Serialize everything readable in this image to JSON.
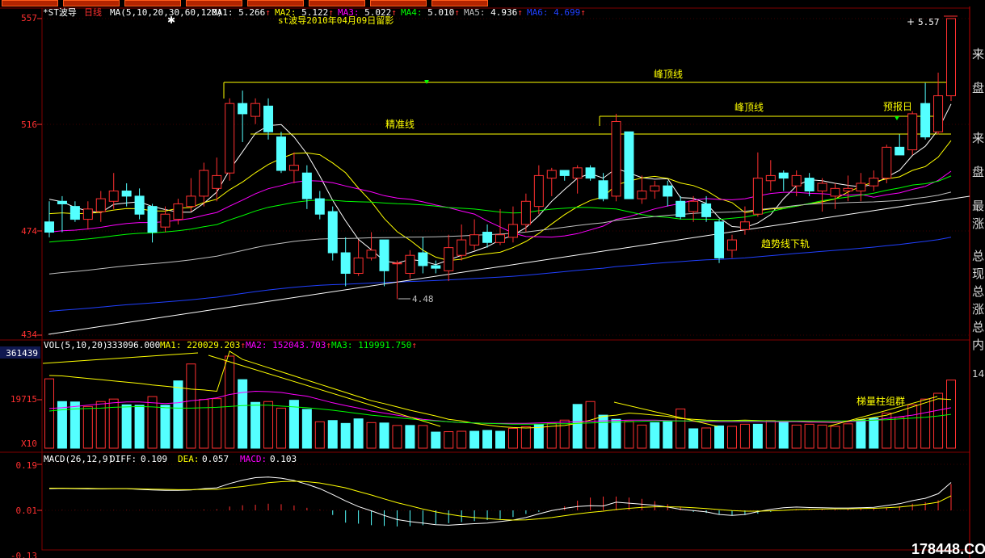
{
  "toolbar": {
    "button_count": 8
  },
  "main": {
    "stock_name": "*ST波导",
    "period": "日线",
    "ma_header": "MA(5,10,20,30,60,120)",
    "ma_values": [
      {
        "label": "MA1:",
        "value": "5.266",
        "color": "#ffffff"
      },
      {
        "label": "MA2:",
        "value": "5.122",
        "color": "#ffff00"
      },
      {
        "label": "MA3:",
        "value": "5.022",
        "color": "#ff00ff"
      },
      {
        "label": "MA4:",
        "value": "5.010",
        "color": "#00ff00"
      },
      {
        "label": "MA5:",
        "value": "4.936",
        "color": "#c0c0c0"
      },
      {
        "label": "MA6:",
        "value": "4.699",
        "color": "#2040ff"
      }
    ],
    "note": "st波导2010年04月09日留影",
    "y_labels": [
      "557",
      "516",
      "474",
      "434"
    ],
    "max_label": "5.57",
    "min_label": "4.48",
    "annotations": {
      "peak1": "峰顶线",
      "peak2": "峰顶线",
      "precise": "精准线",
      "forecast": "预报日",
      "trend": "趋势线下轨",
      "ladder": "梯量柱组群"
    }
  },
  "volume": {
    "header": "VOL(5,10,20)",
    "vol_value": "333096.000",
    "ma_values": [
      {
        "label": "MA1:",
        "value": "220029.203",
        "color": "#ffff00"
      },
      {
        "label": "MA2:",
        "value": "152043.703",
        "color": "#ff00ff"
      },
      {
        "label": "MA3:",
        "value": "119991.750",
        "color": "#00ff00"
      }
    ],
    "y_top": "361439",
    "y_mid": "19715",
    "unit": "X10"
  },
  "macd": {
    "header": "MACD(26,12,9)",
    "diff": {
      "label": "DIFF:",
      "value": "0.109"
    },
    "dea": {
      "label": "DEA:",
      "value": "0.057"
    },
    "macd": {
      "label": "MACD:",
      "value": "0.103"
    },
    "y_labels": [
      "0.19",
      "0.01",
      "-0.13"
    ]
  },
  "right_panel": [
    "来",
    "盘",
    "来",
    "盘",
    "最",
    "涨",
    "总",
    "现",
    "总",
    "涨",
    "总",
    "内",
    "14"
  ],
  "watermark": "178448.COM",
  "chart_data": {
    "type": "candlestick",
    "ylim": [
      4.34,
      5.57
    ],
    "candles": [
      [
        4.78,
        4.74,
        4.86,
        4.72
      ],
      [
        4.86,
        4.85,
        4.88,
        4.74
      ],
      [
        4.84,
        4.79,
        4.86,
        4.78
      ],
      [
        4.79,
        4.83,
        4.86,
        4.75
      ],
      [
        4.82,
        4.87,
        4.9,
        4.78
      ],
      [
        4.86,
        4.9,
        4.97,
        4.83
      ],
      [
        4.9,
        4.88,
        4.93,
        4.84
      ],
      [
        4.88,
        4.81,
        4.91,
        4.79
      ],
      [
        4.84,
        4.74,
        4.85,
        4.7
      ],
      [
        4.76,
        4.81,
        4.84,
        4.74
      ],
      [
        4.79,
        4.85,
        4.87,
        4.77
      ],
      [
        4.84,
        4.88,
        4.95,
        4.82
      ],
      [
        4.88,
        4.98,
        5.01,
        4.84
      ],
      [
        4.91,
        4.96,
        5.03,
        4.86
      ],
      [
        4.97,
        5.24,
        5.26,
        4.94
      ],
      [
        5.24,
        5.2,
        5.29,
        5.09
      ],
      [
        5.19,
        5.24,
        5.26,
        5.16
      ],
      [
        5.23,
        5.13,
        5.26,
        5.1
      ],
      [
        5.11,
        4.98,
        5.13,
        4.97
      ],
      [
        4.98,
        5.0,
        5.05,
        4.93
      ],
      [
        4.97,
        4.87,
        5.0,
        4.83
      ],
      [
        4.87,
        4.81,
        4.9,
        4.79
      ],
      [
        4.82,
        4.66,
        4.84,
        4.63
      ],
      [
        4.66,
        4.58,
        4.72,
        4.53
      ],
      [
        4.58,
        4.64,
        4.71,
        4.57
      ],
      [
        4.64,
        4.67,
        4.74,
        4.63
      ],
      [
        4.71,
        4.59,
        4.71,
        4.53
      ],
      [
        4.62,
        4.62,
        4.63,
        4.48
      ],
      [
        4.58,
        4.65,
        4.67,
        4.56
      ],
      [
        4.66,
        4.61,
        4.72,
        4.58
      ],
      [
        4.61,
        4.6,
        4.63,
        4.58
      ],
      [
        4.59,
        4.68,
        4.73,
        4.55
      ],
      [
        4.65,
        4.71,
        4.77,
        4.63
      ],
      [
        4.69,
        4.73,
        4.79,
        4.67
      ],
      [
        4.74,
        4.7,
        4.77,
        4.68
      ],
      [
        4.7,
        4.73,
        4.83,
        4.69
      ],
      [
        4.72,
        4.77,
        4.84,
        4.7
      ],
      [
        4.77,
        4.86,
        4.89,
        4.74
      ],
      [
        4.84,
        4.96,
        5.0,
        4.81
      ],
      [
        4.95,
        4.98,
        4.99,
        4.88
      ],
      [
        4.98,
        4.96,
        4.98,
        4.94
      ],
      [
        4.95,
        4.99,
        5.0,
        4.89
      ],
      [
        4.99,
        4.95,
        5.0,
        4.94
      ],
      [
        4.94,
        4.87,
        4.97,
        4.86
      ],
      [
        4.88,
        5.17,
        5.2,
        4.86
      ],
      [
        5.13,
        4.87,
        5.13,
        4.87
      ],
      [
        4.87,
        4.9,
        4.96,
        4.85
      ],
      [
        4.9,
        4.92,
        4.94,
        4.87
      ],
      [
        4.92,
        4.88,
        4.94,
        4.84
      ],
      [
        4.86,
        4.8,
        4.88,
        4.79
      ],
      [
        4.82,
        4.86,
        4.88,
        4.78
      ],
      [
        4.85,
        4.8,
        4.88,
        4.78
      ],
      [
        4.78,
        4.64,
        4.79,
        4.62
      ],
      [
        4.67,
        4.71,
        4.73,
        4.64
      ],
      [
        4.75,
        4.78,
        4.84,
        4.73
      ],
      [
        4.81,
        4.95,
        5.05,
        4.8
      ],
      [
        4.94,
        4.96,
        5.02,
        4.9
      ],
      [
        4.97,
        4.95,
        4.98,
        4.9
      ],
      [
        4.92,
        4.96,
        4.98,
        4.88
      ],
      [
        4.95,
        4.9,
        4.97,
        4.88
      ],
      [
        4.9,
        4.93,
        4.95,
        4.82
      ],
      [
        4.88,
        4.91,
        4.93,
        4.83
      ],
      [
        4.9,
        4.91,
        4.96,
        4.86
      ],
      [
        4.9,
        4.93,
        4.97,
        4.86
      ],
      [
        4.92,
        4.95,
        4.98,
        4.9
      ],
      [
        4.95,
        5.07,
        5.08,
        4.93
      ],
      [
        5.07,
        5.04,
        5.12,
        5.04
      ],
      [
        5.06,
        5.2,
        5.21,
        5.04
      ],
      [
        5.24,
        5.11,
        5.32,
        5.1
      ],
      [
        5.13,
        5.27,
        5.36,
        5.12
      ],
      [
        5.27,
        5.57,
        5.57,
        5.25
      ]
    ],
    "volume_bars": [
      [
        168,
        1
      ],
      [
        113,
        0
      ],
      [
        112,
        0
      ],
      [
        101,
        1
      ],
      [
        113,
        1
      ],
      [
        119,
        1
      ],
      [
        105,
        0
      ],
      [
        104,
        0
      ],
      [
        125,
        1
      ],
      [
        104,
        0
      ],
      [
        163,
        0
      ],
      [
        204,
        1
      ],
      [
        118,
        1
      ],
      [
        120,
        1
      ],
      [
        223,
        1
      ],
      [
        166,
        0
      ],
      [
        111,
        0
      ],
      [
        113,
        1
      ],
      [
        97,
        1
      ],
      [
        116,
        0
      ],
      [
        94,
        0
      ],
      [
        64,
        1
      ],
      [
        67,
        0
      ],
      [
        60,
        0
      ],
      [
        71,
        0
      ],
      [
        62,
        1
      ],
      [
        61,
        0
      ],
      [
        55,
        1
      ],
      [
        55,
        0
      ],
      [
        55,
        1
      ],
      [
        39,
        0
      ],
      [
        40,
        1
      ],
      [
        41,
        1
      ],
      [
        41,
        0
      ],
      [
        43,
        0
      ],
      [
        41,
        0
      ],
      [
        48,
        1
      ],
      [
        52,
        1
      ],
      [
        57,
        0
      ],
      [
        60,
        1
      ],
      [
        68,
        1
      ],
      [
        106,
        0
      ],
      [
        113,
        1
      ],
      [
        80,
        0
      ],
      [
        70,
        0
      ],
      [
        65,
        1
      ],
      [
        56,
        1
      ],
      [
        62,
        0
      ],
      [
        64,
        0
      ],
      [
        95,
        1
      ],
      [
        47,
        0
      ],
      [
        49,
        1
      ],
      [
        54,
        0
      ],
      [
        53,
        1
      ],
      [
        58,
        1
      ],
      [
        58,
        0
      ],
      [
        67,
        1
      ],
      [
        63,
        0
      ],
      [
        56,
        1
      ],
      [
        58,
        1
      ],
      [
        56,
        1
      ],
      [
        53,
        1
      ],
      [
        59,
        1
      ],
      [
        69,
        0
      ],
      [
        73,
        0
      ],
      [
        85,
        1
      ],
      [
        75,
        1
      ],
      [
        105,
        1
      ],
      [
        119,
        1
      ],
      [
        133,
        1
      ],
      [
        165,
        1
      ]
    ],
    "volume_ma": [
      [
        176,
        175,
        172,
        169,
        166,
        163,
        160,
        157,
        153,
        150,
        147,
        143,
        141,
        138,
        235,
        215,
        205,
        195,
        185,
        175,
        165,
        155,
        145,
        135,
        125,
        115,
        108,
        100,
        92,
        85,
        78,
        70,
        66,
        60,
        56,
        52,
        50,
        49,
        50,
        53,
        55,
        60,
        68,
        77,
        80,
        85,
        83,
        80,
        77,
        72,
        70,
        68,
        67,
        67,
        68,
        67,
        66,
        65,
        65,
        64,
        63,
        62,
        65,
        70,
        75,
        80,
        90,
        100,
        110,
        120,
        118
      ],
      [
        96,
        98,
        101,
        104,
        107,
        110,
        112,
        112,
        110,
        108,
        110,
        115,
        118,
        122,
        130,
        135,
        138,
        137,
        135,
        130,
        126,
        118,
        110,
        103,
        97,
        90,
        85,
        80,
        75,
        70,
        67,
        64,
        62,
        61,
        60,
        60,
        60,
        60,
        61,
        62,
        63,
        64,
        65,
        66,
        67,
        68,
        68,
        68,
        67,
        66,
        65,
        64,
        64,
        64,
        64,
        64,
        64,
        64,
        64,
        63,
        63,
        63,
        64,
        66,
        68,
        72,
        76,
        80,
        86,
        92,
        98
      ],
      [
        90,
        93,
        95,
        96,
        97,
        99,
        100,
        101,
        100,
        98,
        97,
        97,
        98,
        99,
        101,
        103,
        104,
        104,
        102,
        100,
        98,
        95,
        92,
        88,
        84,
        80,
        77,
        74,
        71,
        68,
        66,
        64,
        62,
        61,
        60,
        59,
        58,
        58,
        58,
        59,
        59,
        60,
        61,
        62,
        63,
        64,
        65,
        66,
        66,
        66,
        66,
        66,
        66,
        66,
        66,
        66,
        66,
        66,
        66,
        66,
        66,
        66,
        66,
        67,
        68,
        69,
        71,
        73,
        75,
        78,
        82
      ]
    ],
    "macd": {
      "diff": [
        0.085,
        0.086,
        0.085,
        0.084,
        0.084,
        0.085,
        0.085,
        0.082,
        0.08,
        0.078,
        0.078,
        0.08,
        0.085,
        0.088,
        0.105,
        0.118,
        0.128,
        0.13,
        0.126,
        0.117,
        0.102,
        0.085,
        0.062,
        0.037,
        0.015,
        -0.002,
        -0.02,
        -0.036,
        -0.044,
        -0.05,
        -0.056,
        -0.058,
        -0.055,
        -0.052,
        -0.05,
        -0.044,
        -0.038,
        -0.028,
        -0.014,
        -0.001,
        0.008,
        0.015,
        0.018,
        0.017,
        0.032,
        0.028,
        0.024,
        0.02,
        0.013,
        0.004,
        -0.001,
        -0.006,
        -0.016,
        -0.02,
        -0.016,
        -0.005,
        0.004,
        0.01,
        0.013,
        0.011,
        0.01,
        0.009,
        0.009,
        0.01,
        0.012,
        0.019,
        0.026,
        0.038,
        0.047,
        0.065,
        0.109
      ],
      "dea": [
        0.087,
        0.087,
        0.086,
        0.086,
        0.085,
        0.085,
        0.085,
        0.084,
        0.083,
        0.082,
        0.081,
        0.081,
        0.082,
        0.082,
        0.088,
        0.093,
        0.1,
        0.108,
        0.112,
        0.114,
        0.112,
        0.107,
        0.098,
        0.088,
        0.074,
        0.06,
        0.045,
        0.03,
        0.018,
        0.005,
        -0.006,
        -0.015,
        -0.023,
        -0.028,
        -0.032,
        -0.036,
        -0.038,
        -0.037,
        -0.033,
        -0.028,
        -0.021,
        -0.014,
        -0.008,
        -0.003,
        0.003,
        0.008,
        0.012,
        0.014,
        0.014,
        0.013,
        0.01,
        0.007,
        0.003,
        -0.001,
        -0.003,
        -0.003,
        -0.002,
        0.0,
        0.003,
        0.004,
        0.005,
        0.006,
        0.006,
        0.007,
        0.008,
        0.01,
        0.013,
        0.018,
        0.024,
        0.032,
        0.057
      ],
      "hist": [
        0,
        0.001,
        0.001,
        0.001,
        0.001,
        0.001,
        0.001,
        0.001,
        0.001,
        0.001,
        0.001,
        0.001,
        0.003,
        0.004,
        0.015,
        0.02,
        0.022,
        0.026,
        0.024,
        0.019,
        0.01,
        0.002,
        -0.018,
        -0.048,
        -0.052,
        -0.058,
        -0.061,
        -0.063,
        -0.062,
        -0.058,
        -0.054,
        -0.05,
        -0.046,
        -0.042,
        -0.038,
        -0.034,
        -0.026,
        -0.014,
        -0.006,
        0.001,
        0.016,
        0.038,
        0.05,
        0.054,
        0.054,
        0.05,
        0.045,
        0.036,
        0.024,
        0.012,
        -0.006,
        -0.01,
        -0.016,
        -0.02,
        -0.018,
        -0.013,
        -0.006,
        -0.001,
        0.002,
        0.003,
        0.003,
        0.003,
        0.004,
        0.005,
        0.006,
        0.01,
        0.016,
        0.026,
        0.032,
        0.04,
        0.103
      ]
    }
  }
}
